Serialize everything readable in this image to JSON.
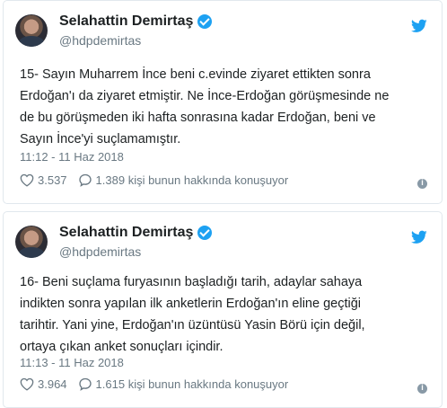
{
  "tweets": [
    {
      "author_name": "Selahattin Demirtaş",
      "handle": "@hdpdemirtas",
      "text": "15- Sayın Muharrem İnce beni c.evinde ziyaret ettikten sonra\nErdoğan'ı da ziyaret etmiştir. Ne İnce-Erdoğan görüşmesinde ne\nde bu görüşmeden iki hafta sonrasına kadar Erdoğan, beni ve\nSayın İnce'yi suçlamamıştır.",
      "timestamp": "11:12 - 11 Haz 2018",
      "likes": "3.537",
      "replies_text": "1.389 kişi bunun hakkında konuşuyor"
    },
    {
      "author_name": "Selahattin Demirtaş",
      "handle": "@hdpdemirtas",
      "text": "16- Beni suçlama furyasının başladığı tarih, adaylar sahaya\nindikten sonra yapılan ilk anketlerin Erdoğan'ın eline geçtiği\ntarihtir. Yani yine, Erdoğan'ın üzüntüsü Yasin Börü için değil,\nortaya çıkan anket sonuçları içindir.",
      "timestamp": "11:13 - 11 Haz 2018",
      "likes": "3.964",
      "replies_text": "1.615 kişi bunun hakkında konuşuyor"
    }
  ],
  "icons": {
    "verified": "verified-badge-icon",
    "brand": "twitter-bird-icon",
    "like": "heart-icon",
    "reply": "speech-bubble-icon",
    "info": "info-icon"
  },
  "colors": {
    "brand_blue": "#1da1f2",
    "secondary_text": "#697882",
    "border": "#e1e8ed"
  }
}
